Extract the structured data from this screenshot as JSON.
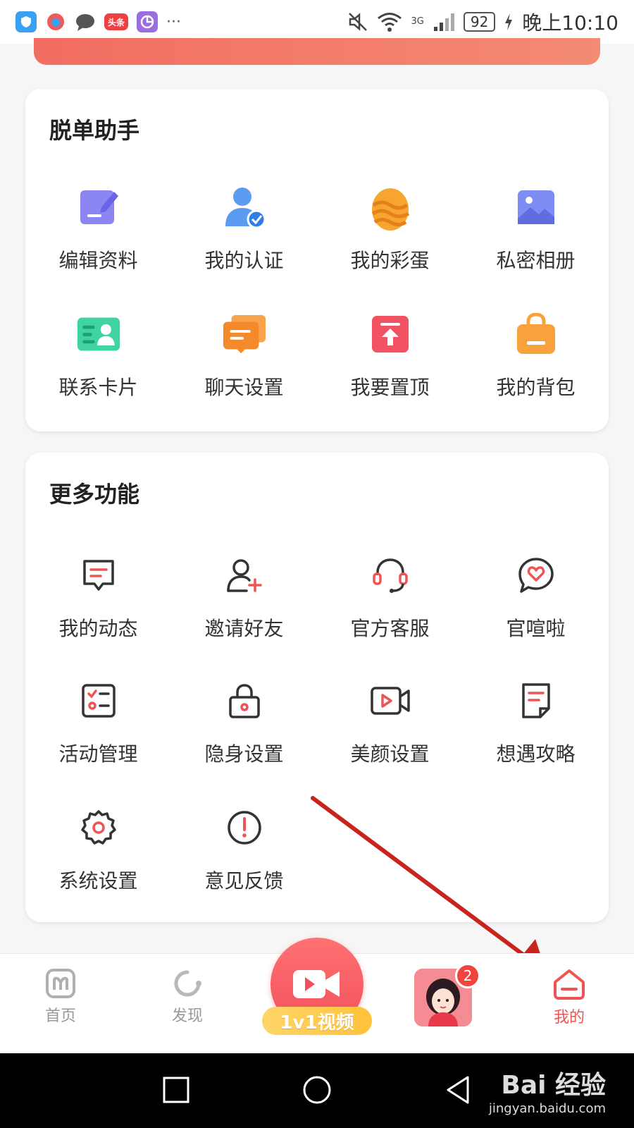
{
  "status_bar": {
    "apps": [
      {
        "icon": "shield-app-icon",
        "color": "#3aa0f2"
      },
      {
        "icon": "weibo-app-icon",
        "color": "#f05a5a"
      },
      {
        "icon": "message-app-icon",
        "color": "#555555"
      },
      {
        "icon": "toutiao-app-icon",
        "color": "#f04142",
        "label": "头条"
      },
      {
        "icon": "chart-app-icon",
        "color": "#9a6ee0"
      }
    ],
    "more": "···",
    "network": "3G",
    "battery": "92",
    "time": "晚上10:10"
  },
  "section1": {
    "title": "脱单助手",
    "items": [
      {
        "label": "编辑资料",
        "icon": "edit-profile-icon"
      },
      {
        "label": "我的认证",
        "icon": "verified-user-icon"
      },
      {
        "label": "我的彩蛋",
        "icon": "easter-egg-icon"
      },
      {
        "label": "私密相册",
        "icon": "private-album-icon"
      },
      {
        "label": "联系卡片",
        "icon": "contact-card-icon"
      },
      {
        "label": "聊天设置",
        "icon": "chat-settings-icon"
      },
      {
        "label": "我要置顶",
        "icon": "pin-top-icon"
      },
      {
        "label": "我的背包",
        "icon": "backpack-icon"
      }
    ]
  },
  "section2": {
    "title": "更多功能",
    "items": [
      {
        "label": "我的动态",
        "icon": "my-posts-icon"
      },
      {
        "label": "邀请好友",
        "icon": "invite-friend-icon"
      },
      {
        "label": "官方客服",
        "icon": "customer-service-icon"
      },
      {
        "label": "官喧啦",
        "icon": "heart-bubble-icon"
      },
      {
        "label": "活动管理",
        "icon": "activity-manage-icon"
      },
      {
        "label": "隐身设置",
        "icon": "lock-icon"
      },
      {
        "label": "美颜设置",
        "icon": "beauty-camera-icon"
      },
      {
        "label": "想遇攻略",
        "icon": "guide-doc-icon"
      },
      {
        "label": "系统设置",
        "icon": "gear-icon"
      },
      {
        "label": "意见反馈",
        "icon": "feedback-icon"
      }
    ]
  },
  "bottom_nav": {
    "home": "首页",
    "discover": "发现",
    "video": "1v1视频",
    "badge_count": "2",
    "mine": "我的"
  },
  "colors": {
    "accent": "#ef5454",
    "arrow": "#c9241c"
  },
  "watermark": {
    "main": "Bai 经验",
    "sub": "jingyan.baidu.com"
  }
}
